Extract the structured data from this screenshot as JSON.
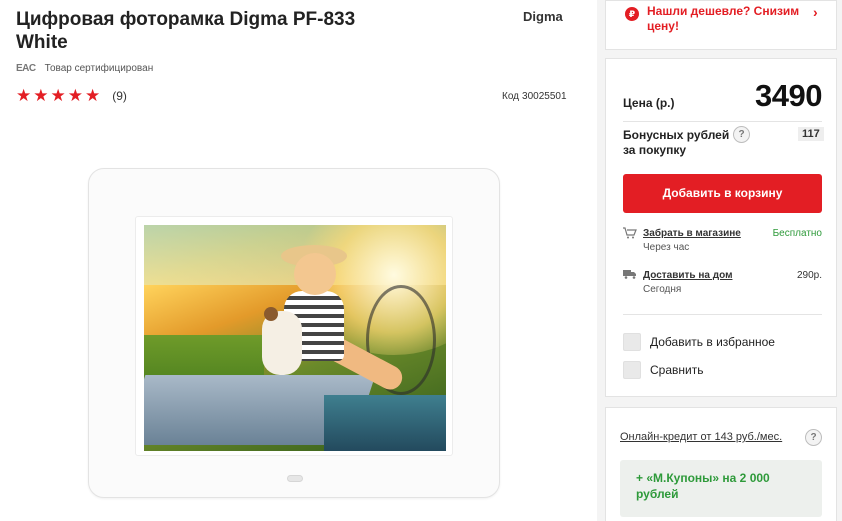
{
  "product": {
    "title": "Цифровая фоторамка Digma PF-833 White",
    "brand": "Digma",
    "certified_badge": "EAC",
    "certified_text": "Товар сертифицирован",
    "rating_stars": 5,
    "reviews_count": "(9)",
    "code_label": "Код",
    "code_value": "30025501"
  },
  "promo": {
    "icon": "ruble-tag-icon",
    "text": "Нашли дешевле? Снизим цену!",
    "chevron": "›"
  },
  "buy": {
    "price_label": "Цена (р.)",
    "price": "3490",
    "bonus_label": "Бонусных рублей за покупку",
    "bonus_help": "?",
    "bonus_value": "117",
    "add_to_cart": "Добавить в корзину",
    "delivery": [
      {
        "icon": "cart-icon",
        "link": "Забрать в магазине",
        "sub": "Через час",
        "price": "Бесплатно",
        "free": true
      },
      {
        "icon": "truck-icon",
        "link": "Доставить на дом",
        "sub": "Сегодня",
        "price": "290р.",
        "free": false
      }
    ],
    "favorite_label": "Добавить в избранное",
    "compare_label": "Сравнить"
  },
  "credit": {
    "link": "Онлайн-кредит от 143 руб./мес.",
    "help": "?",
    "coupon": "+ «М.Купоны» на 2 000 рублей"
  },
  "colors": {
    "accent": "#e31e24",
    "green": "#2e9a3a"
  }
}
